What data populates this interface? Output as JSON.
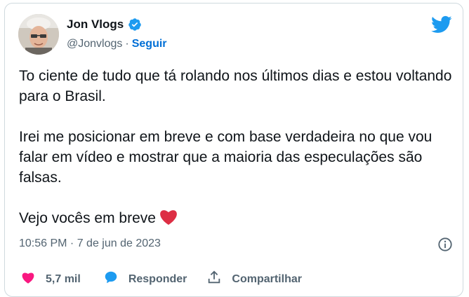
{
  "author": {
    "name": "Jon Vlogs",
    "handle": "@Jonvlogs",
    "separator": "·",
    "follow_label": "Seguir"
  },
  "tweet": {
    "paragraph1": "To ciente de tudo que tá rolando nos últimos dias e estou voltando para o Brasil.",
    "paragraph2": "Irei me posicionar em breve e com base verdadeira no que vou falar em vídeo e mostrar que a maioria das especulações são falsas.",
    "paragraph3": "Vejo vocês em breve",
    "timestamp": "10:56 PM · 7 de jun de 2023"
  },
  "actions": {
    "likes": "5,7 mil",
    "reply_label": "Responder",
    "share_label": "Compartilhar"
  },
  "icons": {
    "verified": "verified-badge-icon",
    "brand": "twitter-bird-icon",
    "info": "info-icon",
    "like": "heart-icon",
    "reply": "reply-bubble-icon",
    "share": "share-upload-icon"
  },
  "colors": {
    "brand": "#1d9bf0",
    "like": "#f91880",
    "follow": "#006fd6",
    "muted": "#536471"
  }
}
